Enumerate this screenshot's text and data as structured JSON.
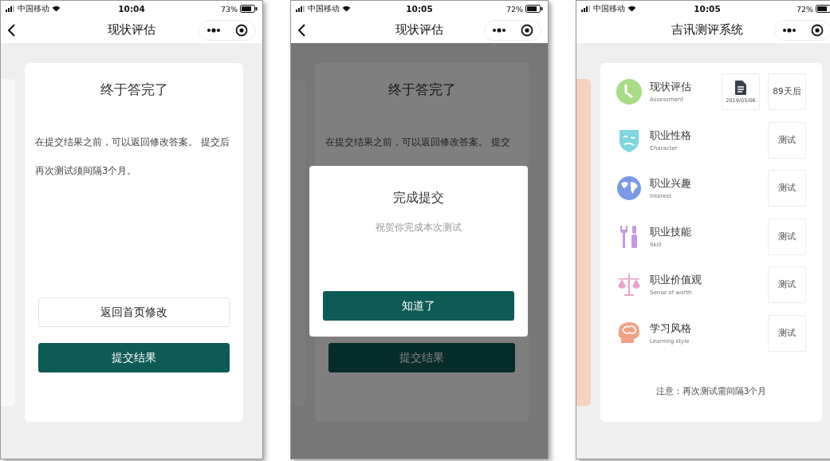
{
  "phones": [
    {
      "kind": "finish",
      "status": {
        "carrier": "中国移动",
        "time": "10:04",
        "battery": "73%"
      },
      "title": "现状评估",
      "back": true,
      "card": {
        "heading": "终于答完了",
        "text": "在提交结果之前，可以返回修改答案。 提交后再次测试须间隔3个月。",
        "buttons": [
          {
            "label": "返回首页修改",
            "primary": false
          },
          {
            "label": "提交结果",
            "primary": true
          }
        ]
      }
    },
    {
      "kind": "dialog",
      "status": {
        "carrier": "中国移动",
        "time": "10:05",
        "battery": "72%"
      },
      "title": "现状评估",
      "back": true,
      "card": {
        "heading": "终于答完了",
        "text": "在提交结果之前，可以返回修改答案。 提交",
        "buttons": [
          {
            "label": "提交结果",
            "primary": true
          }
        ]
      },
      "dialog": {
        "title": "完成提交",
        "message": "祝贺你完成本次测试",
        "button": "知道了"
      }
    },
    {
      "kind": "list",
      "status": {
        "carrier": "中国移动",
        "time": "10:05",
        "battery": "72%"
      },
      "title": "吉讯测评系统",
      "back": false,
      "items": [
        {
          "kind": "done",
          "title": "现状评估",
          "subtitle": "Assessment",
          "date": "2019/05/06",
          "action": "89天后"
        },
        {
          "kind": "test",
          "title": "职业性格",
          "subtitle": "Character",
          "action": "测试"
        },
        {
          "kind": "test",
          "title": "职业兴趣",
          "subtitle": "Interest",
          "action": "测试"
        },
        {
          "kind": "test",
          "title": "职业技能",
          "subtitle": "Skill",
          "action": "测试"
        },
        {
          "kind": "test",
          "title": "职业价值观",
          "subtitle": "Sense of worth",
          "action": "测试"
        },
        {
          "kind": "test",
          "title": "学习风格",
          "subtitle": "Learning style",
          "action": "测试"
        }
      ],
      "note": "注意：再次测试需间隔3个月"
    }
  ]
}
